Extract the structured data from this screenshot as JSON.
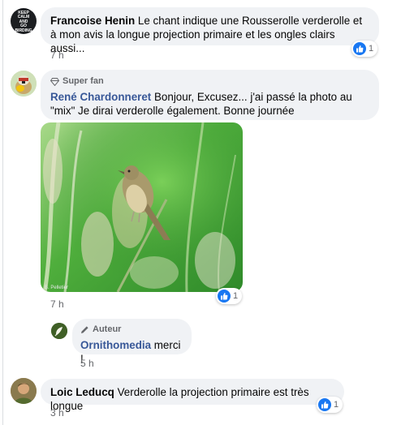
{
  "comments": [
    {
      "author": "Francoise Henin",
      "text": "Le chant indique une Rousserolle verderolle et à mon avis la longue projection primaire et les ongles clairs aussi...",
      "time": "7 h",
      "reaction_count": "1",
      "avatar_text": [
        "KEEP",
        "CALM",
        "AND",
        "GO",
        "BIRDING"
      ]
    },
    {
      "badge": "Super fan",
      "author": "René Chardonneret",
      "text": "Bonjour, Excusez... j'ai passé la photo au \"mix\" Je dirai verderolle également. Bonne journée",
      "time": "7 h",
      "reaction_count": "1",
      "photo_watermark": "B. Pelletier",
      "reply": {
        "badge": "Auteur",
        "author": "Ornithomedia",
        "text": "merci !",
        "time": "5 h"
      }
    },
    {
      "author": "Loic Leducq",
      "text": "Verderolle la projection primaire est très longue",
      "time": "3 h",
      "reaction_count": "1"
    }
  ],
  "colors": {
    "bubble_bg": "#f0f2f5",
    "like_blue": "#1877f2",
    "link_blue": "#385898",
    "meta_gray": "#65676b"
  },
  "icons": [
    "like-icon",
    "diamond-icon",
    "pencil-icon"
  ]
}
